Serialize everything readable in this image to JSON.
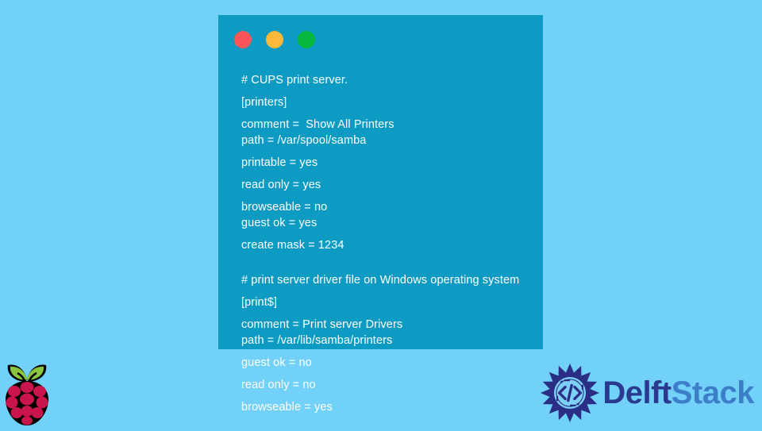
{
  "window": {
    "controls": [
      {
        "name": "close",
        "color": "#f9555a"
      },
      {
        "name": "minimize",
        "color": "#fcb93c"
      },
      {
        "name": "maximize",
        "color": "#07b83e"
      }
    ]
  },
  "code": {
    "lines": [
      {
        "text": "# CUPS print server.",
        "spacing": "sm"
      },
      {
        "text": "[printers]",
        "spacing": "md"
      },
      {
        "text": "comment =  Show All Printers",
        "spacing": "md"
      },
      {
        "text": "path = /var/spool/samba",
        "spacing": "sm"
      },
      {
        "text": "printable = yes",
        "spacing": "md"
      },
      {
        "text": "read only = yes",
        "spacing": "md"
      },
      {
        "text": "browseable = no",
        "spacing": "md"
      },
      {
        "text": "guest ok = yes",
        "spacing": "sm"
      },
      {
        "text": "create mask = 1234",
        "spacing": "md"
      },
      {
        "text": "",
        "spacing": "md"
      },
      {
        "text": "# print server driver file on Windows operating system",
        "spacing": "md"
      },
      {
        "text": "[print$]",
        "spacing": "md"
      },
      {
        "text": "comment = Print server Drivers",
        "spacing": "md"
      },
      {
        "text": "path = /var/lib/samba/printers",
        "spacing": "sm"
      },
      {
        "text": "guest ok = no",
        "spacing": "md"
      },
      {
        "text": "read only = no",
        "spacing": "md"
      },
      {
        "text": "browseable = yes",
        "spacing": "md"
      }
    ]
  },
  "branding": {
    "raspberry_pi_alt": "Raspberry Pi logo",
    "delftstack": {
      "first": "Delft",
      "second": "Stack",
      "first_color": "#2a3b8f",
      "second_color": "#3d7ec9"
    }
  },
  "colors": {
    "page_background": "#72d1f8",
    "card_background": "#0d9bc4",
    "code_text": "#ffffff"
  }
}
